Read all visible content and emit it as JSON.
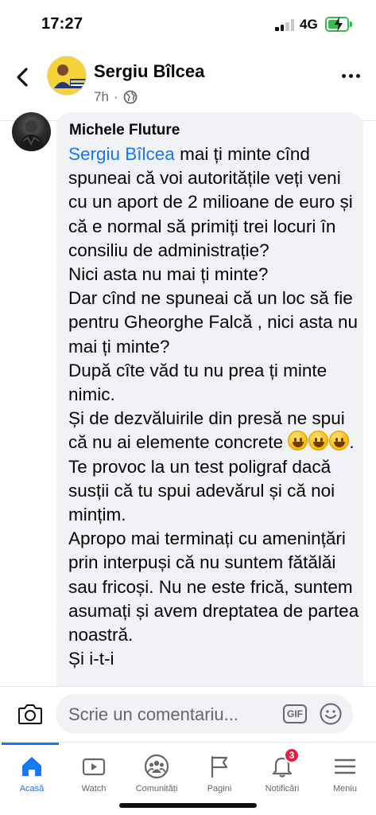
{
  "status_bar": {
    "time": "17:27",
    "network": "4G"
  },
  "header": {
    "name": "Sergiu Bîlcea",
    "time": "7h",
    "dot": "·",
    "avatar_icon": "profile-avatar",
    "privacy_icon": "globe-icon"
  },
  "comment": {
    "author": "Michele Fluture",
    "mention": "Sergiu Bîlcea",
    "text_after_mention": " mai ți minte cînd spuneai că voi autoritățile veți veni cu un aport de 2 milioane de euro și că e normal să primiți trei locuri în consiliu de administrație?\nNici asta nu mai ți minte?\nDar cînd ne spuneai că un loc să fie pentru Gheorghe Falcă , nici asta nu mai ți minte?\nDupă cîte văd tu nu prea ți minte nimic.\nȘi de dezvăluirile din presă ne spui că nu ai elemente concrete ",
    "emoji_suffix": ".",
    "text_end": "\nTe provoc la un test poligraf dacă susții că tu spui adevărul și că noi mințim.\nApropo mai terminați cu amenințări prin interpuși că nu suntem fătălăi sau fricoși. Nu ne este frică, suntem asumați și avem dreptatea de partea noastră.\nȘi i-t-i"
  },
  "composer": {
    "placeholder": "Scrie un comentariu...",
    "gif_label": "GIF"
  },
  "bottom_nav": {
    "items": [
      {
        "label": "Acasă",
        "icon": "home-icon",
        "active": true
      },
      {
        "label": "Watch",
        "icon": "watch-icon"
      },
      {
        "label": "Comunități",
        "icon": "groups-icon"
      },
      {
        "label": "Pagini",
        "icon": "flag-icon"
      },
      {
        "label": "Notificări",
        "icon": "bell-icon",
        "badge": "3"
      },
      {
        "label": "Meniu",
        "icon": "menu-icon"
      }
    ]
  },
  "colors": {
    "accent": "#1877f2",
    "badge": "#e41e3f",
    "bubble": "#f0f2f5",
    "battery": "#2fbf4a"
  }
}
